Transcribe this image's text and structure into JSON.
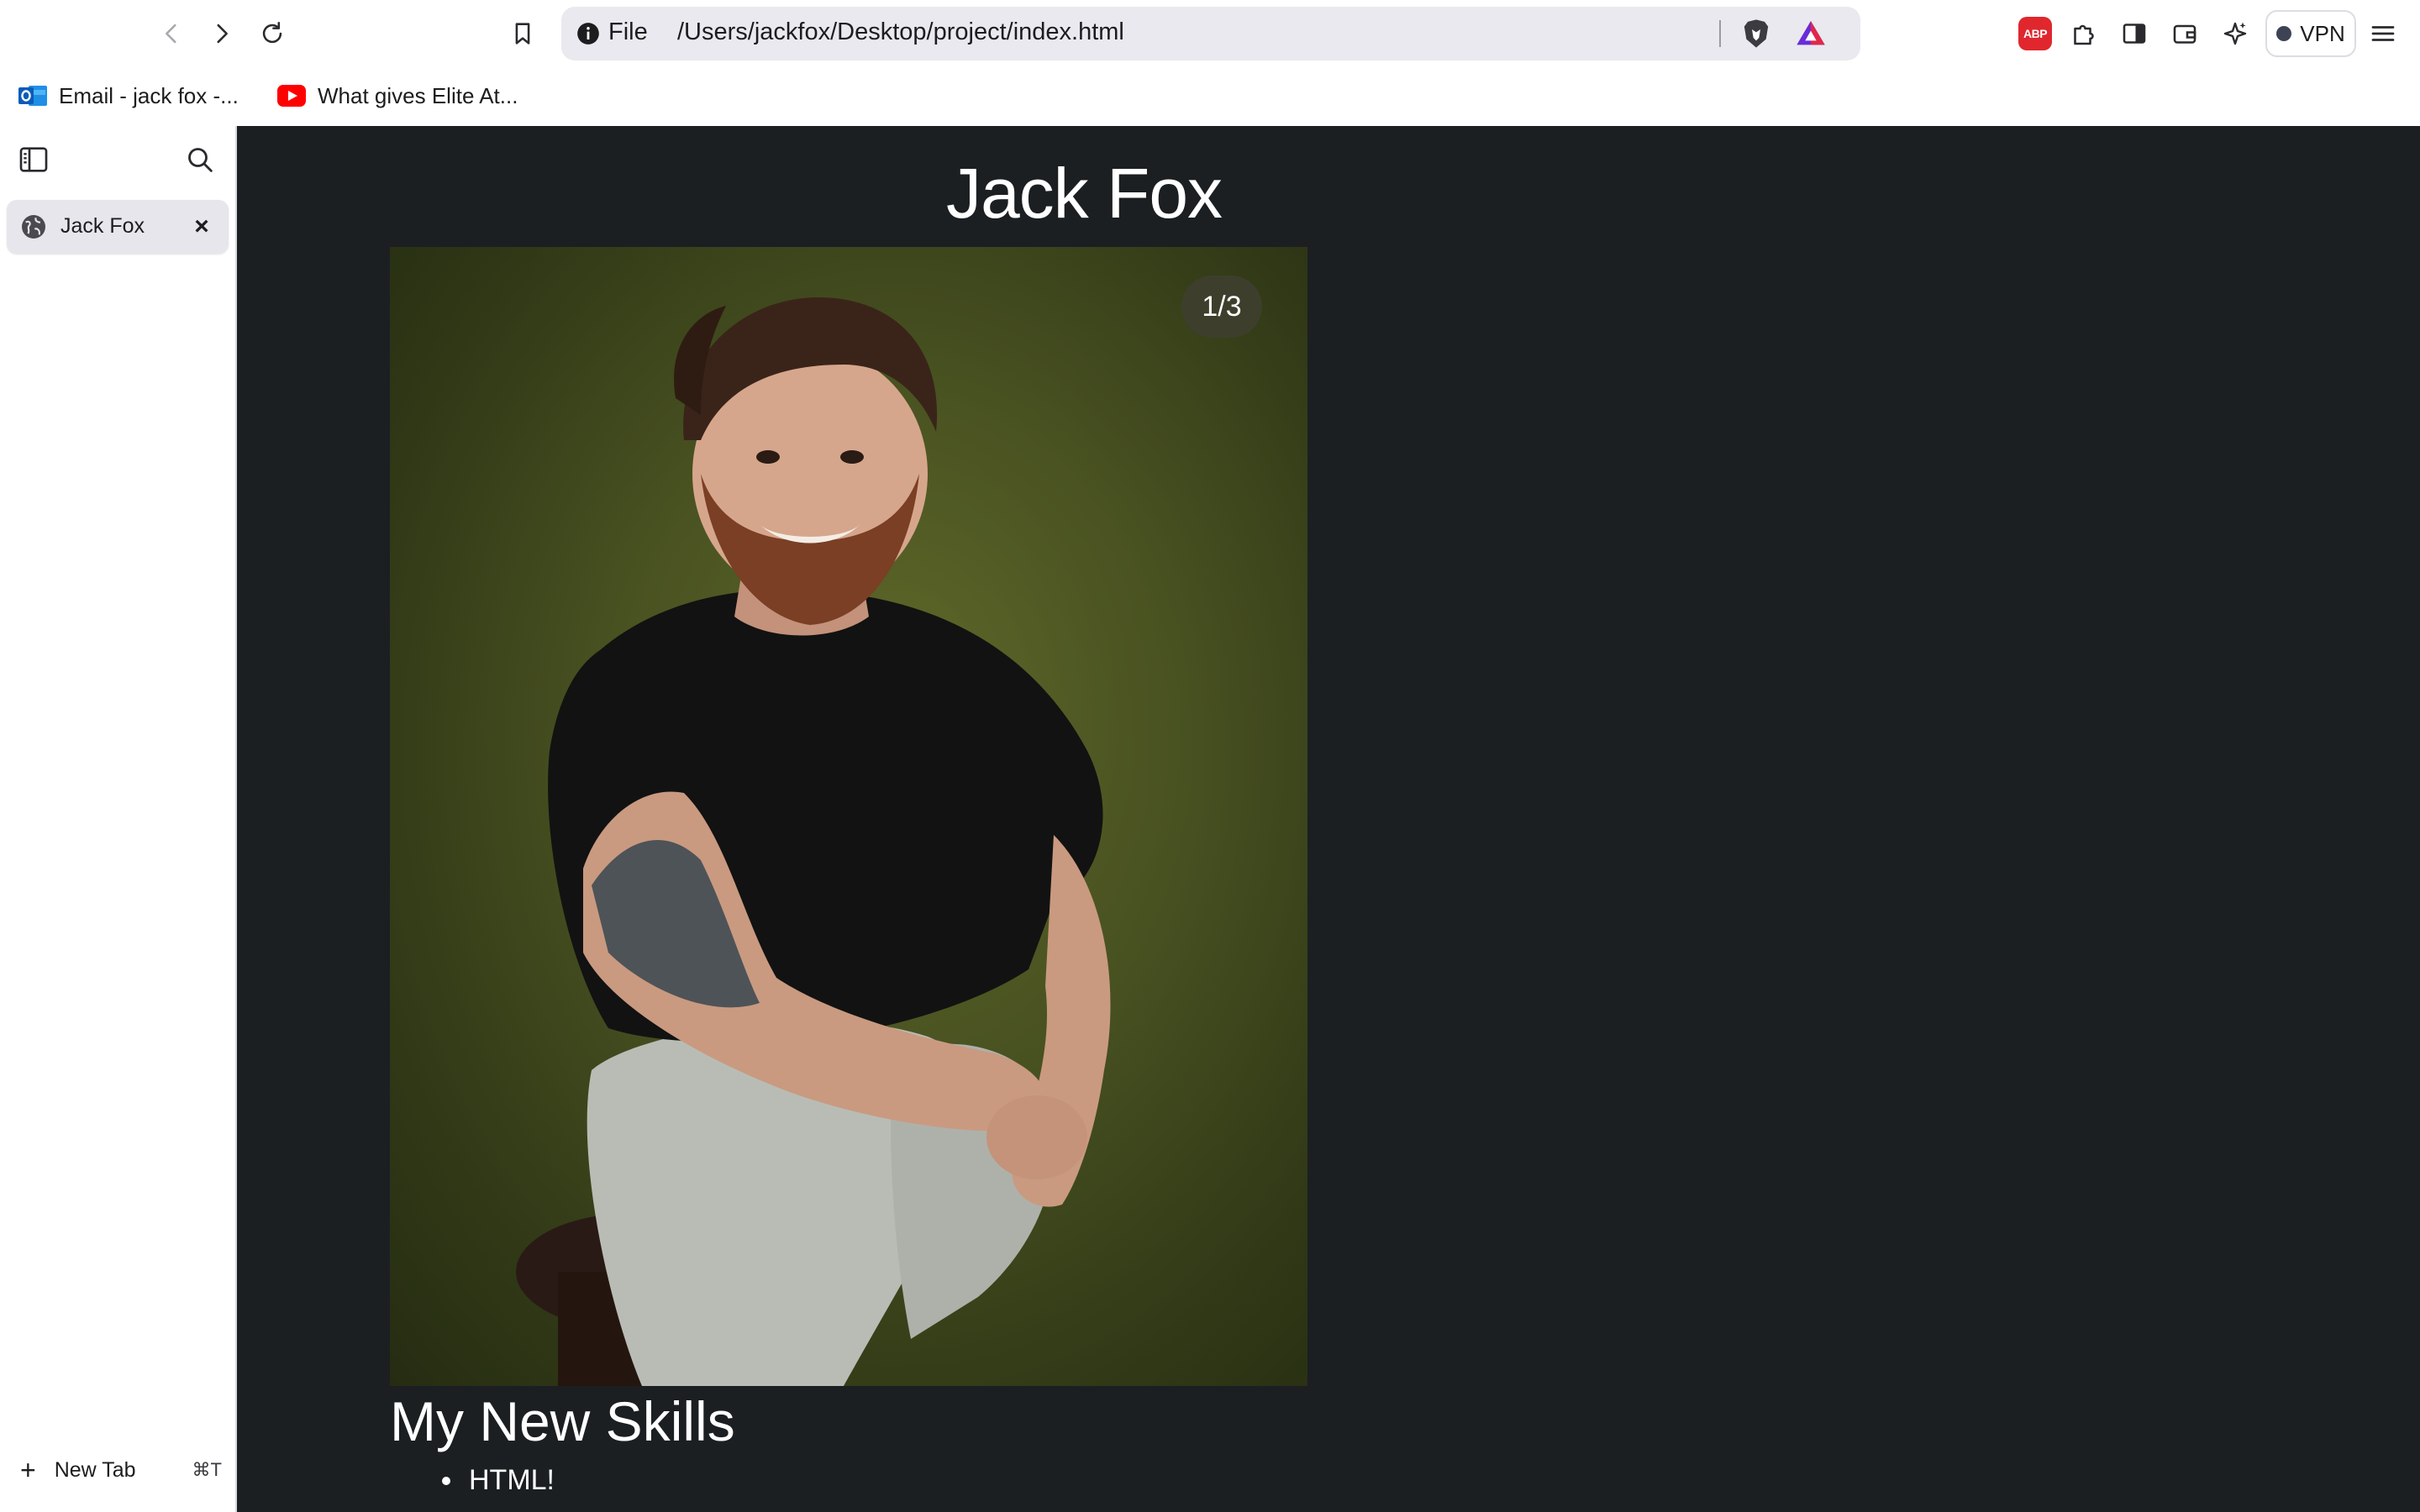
{
  "browser": {
    "url_scheme": "File",
    "url_path": "/Users/jackfox/Desktop/project/index.html",
    "vpn_label": "VPN",
    "abp_label": "ABP"
  },
  "bookmarks": [
    {
      "label": "Email - jack fox -...",
      "icon": "outlook-icon"
    },
    {
      "label": "What gives Elite At...",
      "icon": "youtube-icon"
    }
  ],
  "sidebar": {
    "tabs": [
      {
        "title": "Jack Fox",
        "icon": "globe-icon",
        "active": true
      }
    ],
    "new_tab_label": "New Tab",
    "new_tab_shortcut": "⌘T"
  },
  "page": {
    "title": "Jack Fox",
    "slideshow": {
      "counter": "1/3"
    },
    "skills_heading": "My New Skills",
    "skills": [
      "HTML!"
    ]
  },
  "colors": {
    "page_background": "#1b1f22",
    "photo_backdrop": "#4a5422",
    "abp_red": "#e0272d",
    "youtube_red": "#ff0000"
  }
}
